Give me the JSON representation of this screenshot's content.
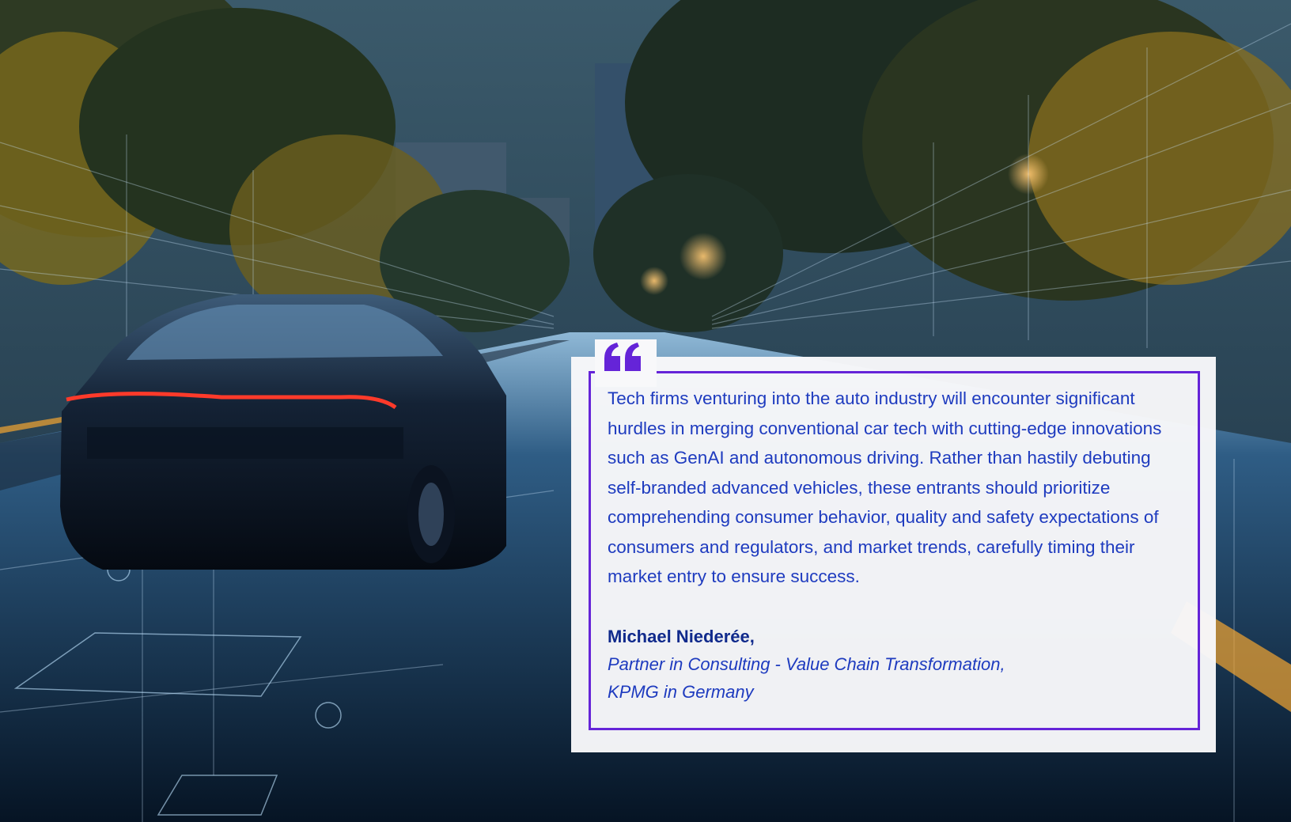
{
  "quote": {
    "icon": "quote-mark-icon",
    "text": "Tech firms venturing into the auto industry will encounter significant hurdles in merging conventional car tech with cutting-edge innovations such as GenAI and autonomous driving. Rather than hastily debuting self-branded advanced vehicles, these entrants should prioritize comprehending consumer behavior, quality and safety expectations of consumers and regulators, and market trends, carefully timing their market entry to ensure success.",
    "author": "Michael Niederée,",
    "role": "Partner in Consulting - Value Chain Transformation,",
    "company": "KPMG in Germany"
  },
  "colors": {
    "accent": "#6524d8",
    "text": "#1e3bbf",
    "author": "#102a8c",
    "card": "#f8f8fa"
  }
}
